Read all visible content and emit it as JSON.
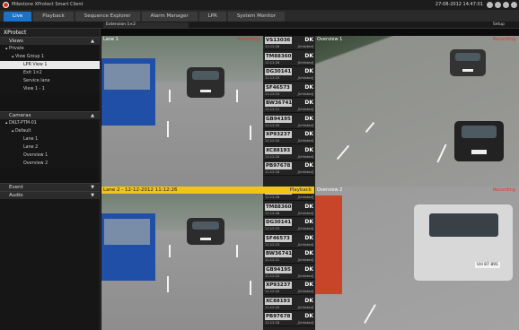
{
  "app": {
    "title": "Milestone XProtect Smart Client",
    "datetime": "27-08-2012 14:47:01"
  },
  "tabs": [
    "Live",
    "Playback",
    "Sequence Explorer",
    "Alarm Manager",
    "LPR",
    "System Monitor"
  ],
  "toolbar": {
    "view": "Extension 1×2",
    "setup": "Setup"
  },
  "sidebar": {
    "heading": "XProtect",
    "views": {
      "title": "Views",
      "items": [
        "Private",
        "View Group 1",
        "LPR View 1",
        "Exit 1×2",
        "Service lane",
        "View 1 - 1"
      ]
    },
    "cameras": {
      "title": "Cameras",
      "items": [
        "DKLT-PTM-01",
        "Default",
        "Lane 1",
        "Lane 2",
        "Overview 1",
        "Overview 2"
      ]
    },
    "event": {
      "title": "Event"
    },
    "audio": {
      "title": "Audio"
    }
  },
  "views": {
    "lane1": {
      "label": "Lane 1",
      "status": "Recording"
    },
    "overview1": {
      "label": "Overview 1",
      "status": "Recording"
    },
    "lane2": {
      "label": "Lane 2 - 12-12-2012 11:12:26",
      "status": "Playback"
    },
    "overview2": {
      "label": "Overview 2",
      "status": "Recording"
    },
    "overview2_plate": "UH 87 891"
  },
  "plates_top": [
    {
      "plate": "VS13036",
      "country": "DK",
      "time": "11:12:26",
      "status": "[Unlisted]"
    },
    {
      "plate": "TM88360",
      "country": "DK",
      "time": "11:12:26",
      "status": "[Unlisted]"
    },
    {
      "plate": "DG30141",
      "country": "DK",
      "time": "11:12:23",
      "status": "[Unlisted]"
    },
    {
      "plate": "SF46573",
      "country": "DK",
      "time": "11:12:23",
      "status": "[Unlisted]"
    },
    {
      "plate": "BW36741",
      "country": "DK",
      "time": "11:12:21",
      "status": "[Unlisted]"
    },
    {
      "plate": "GB94195",
      "country": "DK",
      "time": "11:12:20",
      "status": "[Unlisted]"
    },
    {
      "plate": "XP93237",
      "country": "DK",
      "time": "11:12:20",
      "status": "[Unlisted]"
    },
    {
      "plate": "XC88193",
      "country": "DK",
      "time": "11:12:20",
      "status": "[Unlisted]"
    },
    {
      "plate": "PB97678",
      "country": "DK",
      "time": "11:12:18",
      "status": "[Unlisted]"
    }
  ],
  "plates_bottom": [
    {
      "plate": "VS13036",
      "country": "DK",
      "time": "11:12:26",
      "status": "[Unlisted]"
    },
    {
      "plate": "TM88360",
      "country": "DK",
      "time": "11:12:26",
      "status": "[Unlisted]"
    },
    {
      "plate": "DG30141",
      "country": "DK",
      "time": "11:12:23",
      "status": "[Unlisted]"
    },
    {
      "plate": "SF46573",
      "country": "DK",
      "time": "11:12:23",
      "status": "[Unlisted]"
    },
    {
      "plate": "BW36741",
      "country": "DK",
      "time": "11:12:21",
      "status": "[Unlisted]"
    },
    {
      "plate": "GB94195",
      "country": "DK",
      "time": "11:12:20",
      "status": "[Unlisted]"
    },
    {
      "plate": "XP93237",
      "country": "DK",
      "time": "11:12:20",
      "status": "[Unlisted]"
    },
    {
      "plate": "XC88193",
      "country": "DK",
      "time": "11:12:20",
      "status": "[Unlisted]"
    },
    {
      "plate": "PB97678",
      "country": "DK",
      "time": "11:12:18",
      "status": "[Unlisted]"
    }
  ]
}
